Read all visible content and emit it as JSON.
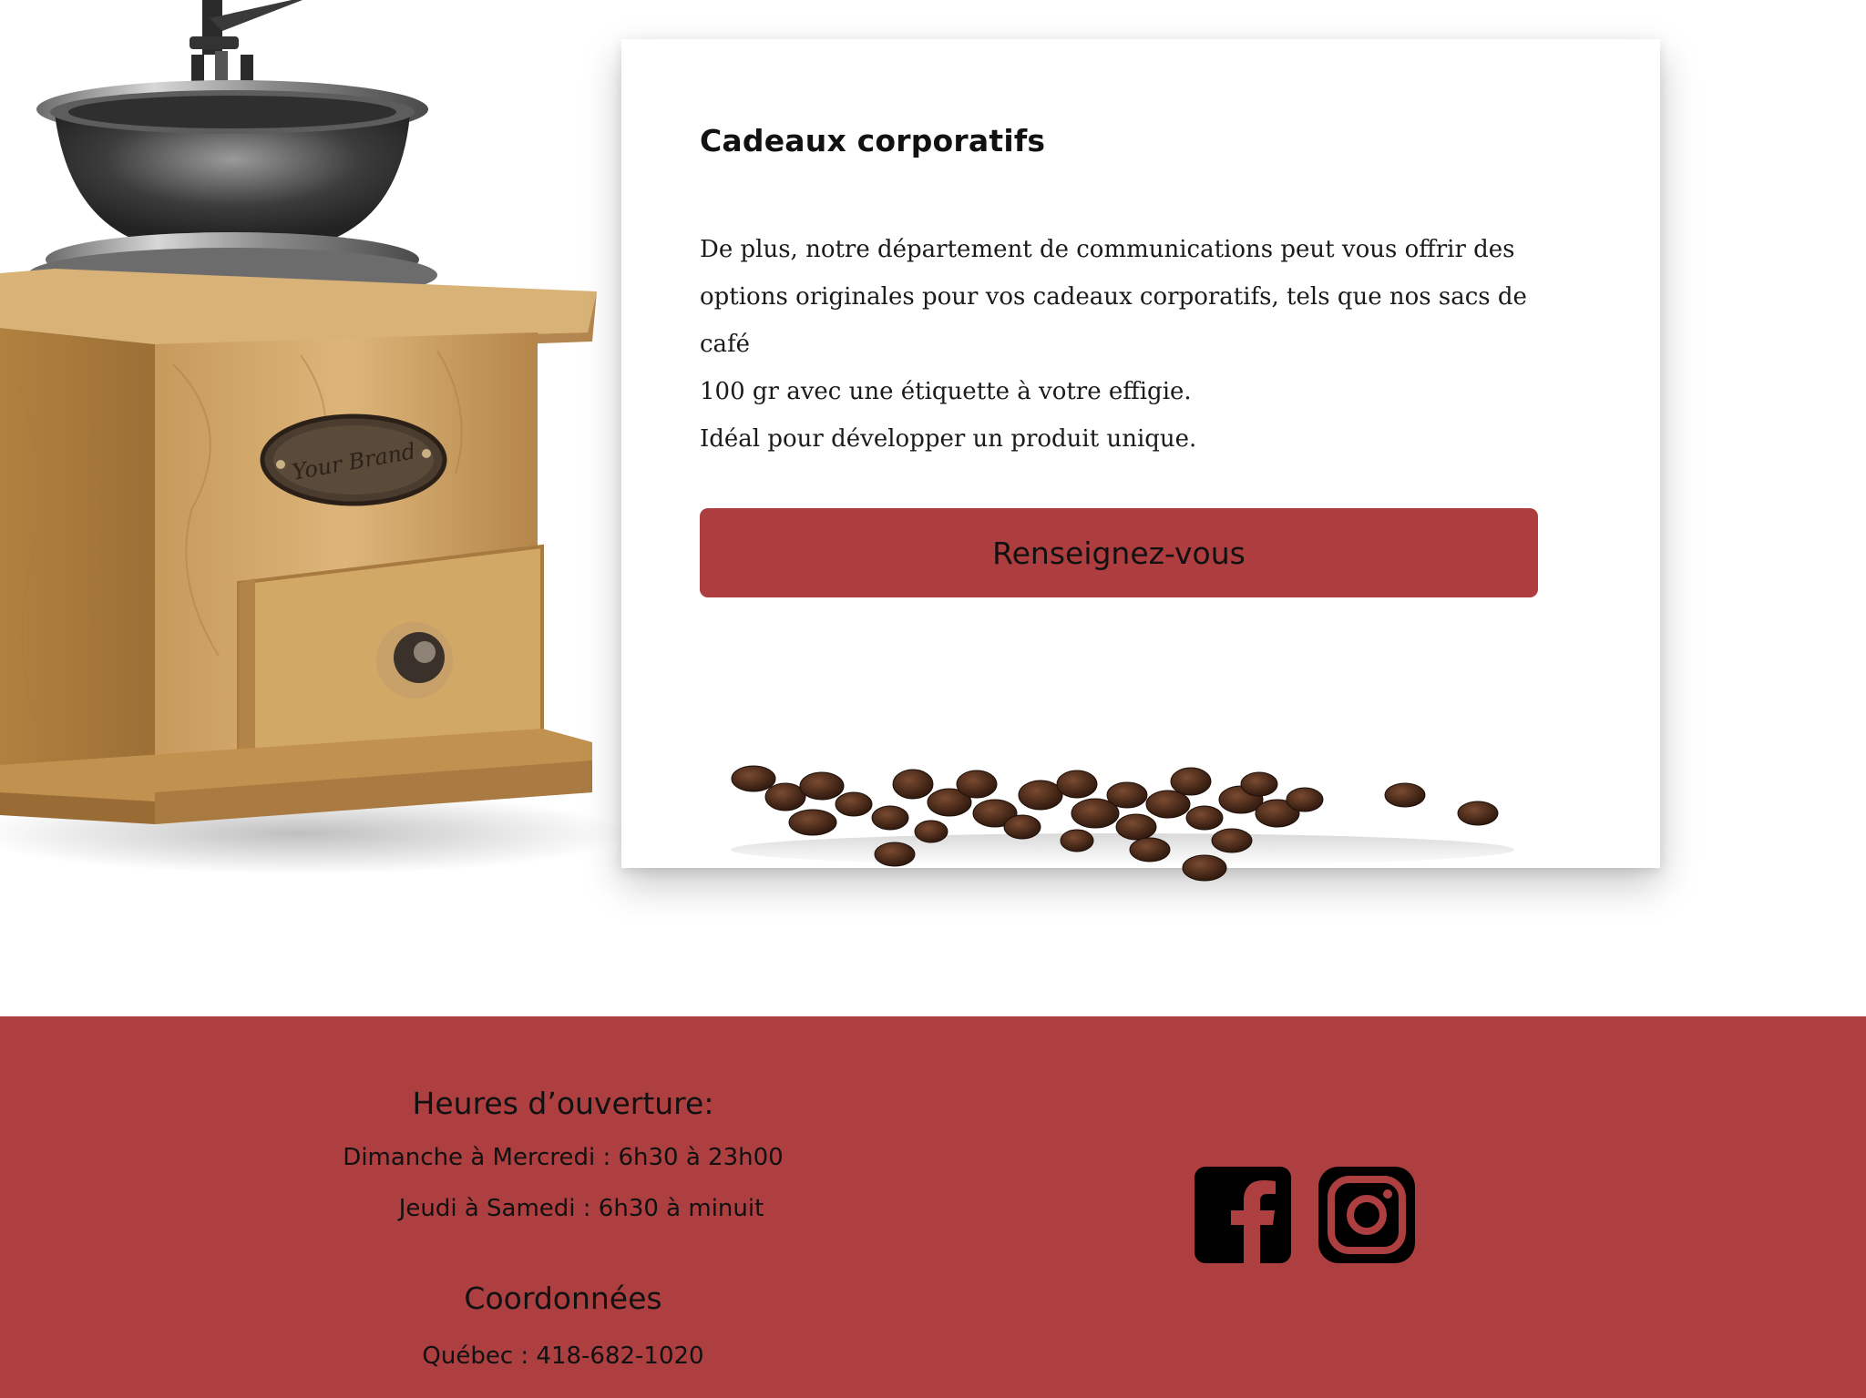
{
  "card": {
    "title": "Cadeaux corporatifs",
    "body_lines": [
      "De plus, notre département de communications peut vous offrir des",
      "options originales pour vos cadeaux corporatifs, tels que nos sacs de café",
      "100 gr avec une étiquette à votre effigie.",
      "Idéal pour développer un produit unique."
    ],
    "cta_label": "Renseignez-vous"
  },
  "illustration": {
    "grinder_plate": "Your Brand"
  },
  "footer": {
    "hours_title": "Heures d’ouverture:",
    "hours_line1": "Dimanche à Mercredi : 6h30 à 23h00",
    "hours_line2": "Jeudi à Samedi : 6h30 à minuit",
    "contact_title": "Coordonnées",
    "contact_phone": "Québec : 418-682-1020",
    "social_icons": [
      "facebook-icon",
      "instagram-icon"
    ]
  },
  "colors": {
    "brand_red": "#ad3f40",
    "button_red": "#ad3d3f",
    "text_dark": "#111111"
  }
}
